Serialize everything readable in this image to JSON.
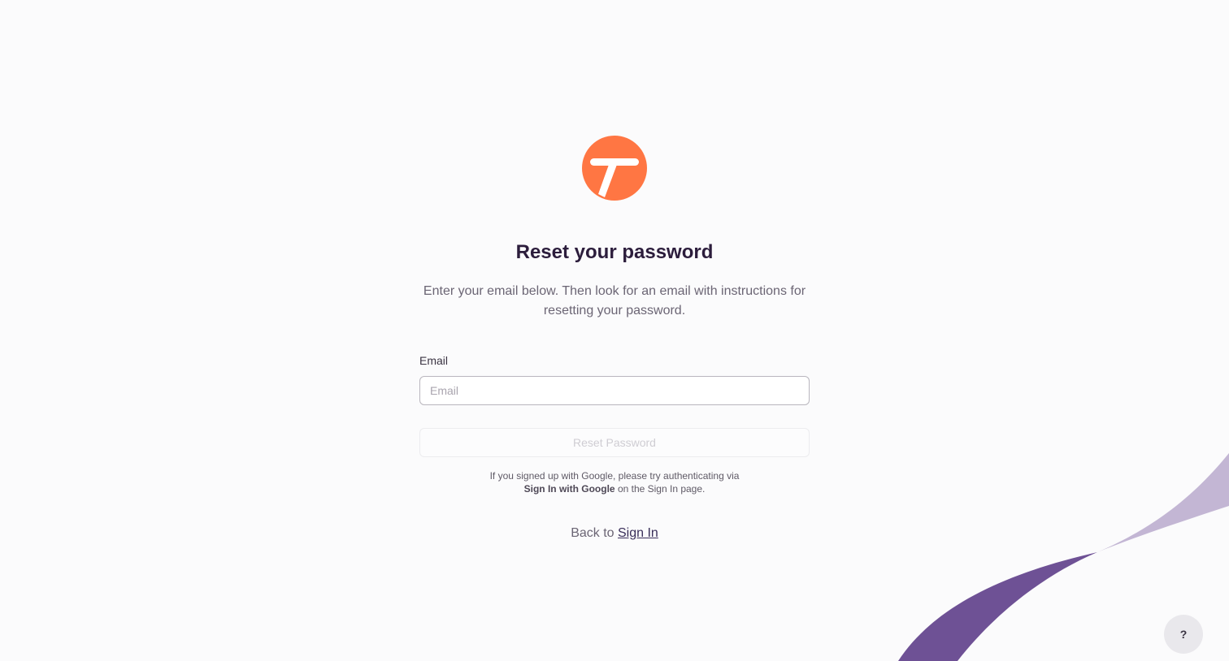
{
  "colors": {
    "background": "#fbfbfc",
    "logo_orange": "#ff7643",
    "ribbon_light": "#c3b6d4",
    "ribbon_dark": "#6e5195",
    "title": "#2c1d3c"
  },
  "logo": {
    "icon": "brand-t-logo"
  },
  "heading": {
    "title": "Reset your password",
    "subtitle": "Enter your email below. Then look for an email with instructions for resetting your password."
  },
  "form": {
    "email_label": "Email",
    "email_placeholder": "Email",
    "email_value": "",
    "submit_label": "Reset Password"
  },
  "google_note": {
    "line1": "If you signed up with Google, please try authenticating via",
    "bold": "Sign In with Google",
    "rest": " on the Sign In page."
  },
  "back": {
    "prefix": "Back to ",
    "link": "Sign In"
  },
  "help": {
    "label": "?",
    "icon": "help-icon"
  }
}
